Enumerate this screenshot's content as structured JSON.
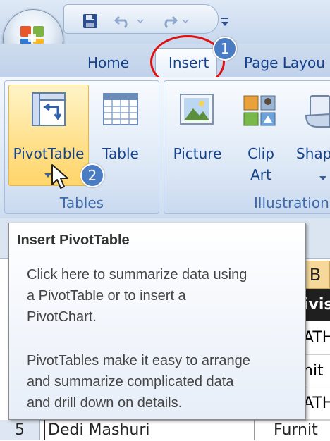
{
  "quick_access": {
    "icons": [
      "save-icon",
      "undo-icon",
      "redo-icon",
      "customize-arrow-icon"
    ]
  },
  "tabs": [
    {
      "label": "Home"
    },
    {
      "label": "Insert",
      "selected": true
    },
    {
      "label": "Page Layou"
    }
  ],
  "ribbon": {
    "tables_group": {
      "label": "Tables",
      "pivottable": {
        "label": "PivotTable",
        "icon": "pivottable-icon"
      },
      "table": {
        "label": "Table",
        "icon": "table-icon"
      }
    },
    "illustrations_group": {
      "label": "Illustration",
      "picture": {
        "label": "Picture",
        "icon": "picture-icon"
      },
      "clipart": {
        "label_line1": "Clip",
        "label_line2": "Art",
        "icon": "clipart-icon"
      },
      "shapes": {
        "label": "Shap",
        "icon": "shapes-icon"
      }
    }
  },
  "annotations": {
    "step1": "1",
    "step2": "2",
    "highlight_color": "#e01010",
    "badge_color": "#4a7cc4"
  },
  "tooltip": {
    "title": "Insert PivotTable",
    "line1": "Click here to summarize data using",
    "line2": "a PivotTable or to insert a",
    "line3": "PivotChart.",
    "line4": "PivotTables make it easy to arrange",
    "line5": "and summarize complicated data",
    "line6": "and drill down on details."
  },
  "sheet": {
    "col_header": "B",
    "cells": [
      "ivis",
      "ATH",
      "nit",
      "ATH"
    ],
    "row_number": "5",
    "row_name": "Dedi Mashuri",
    "row_value": "Furnit"
  }
}
